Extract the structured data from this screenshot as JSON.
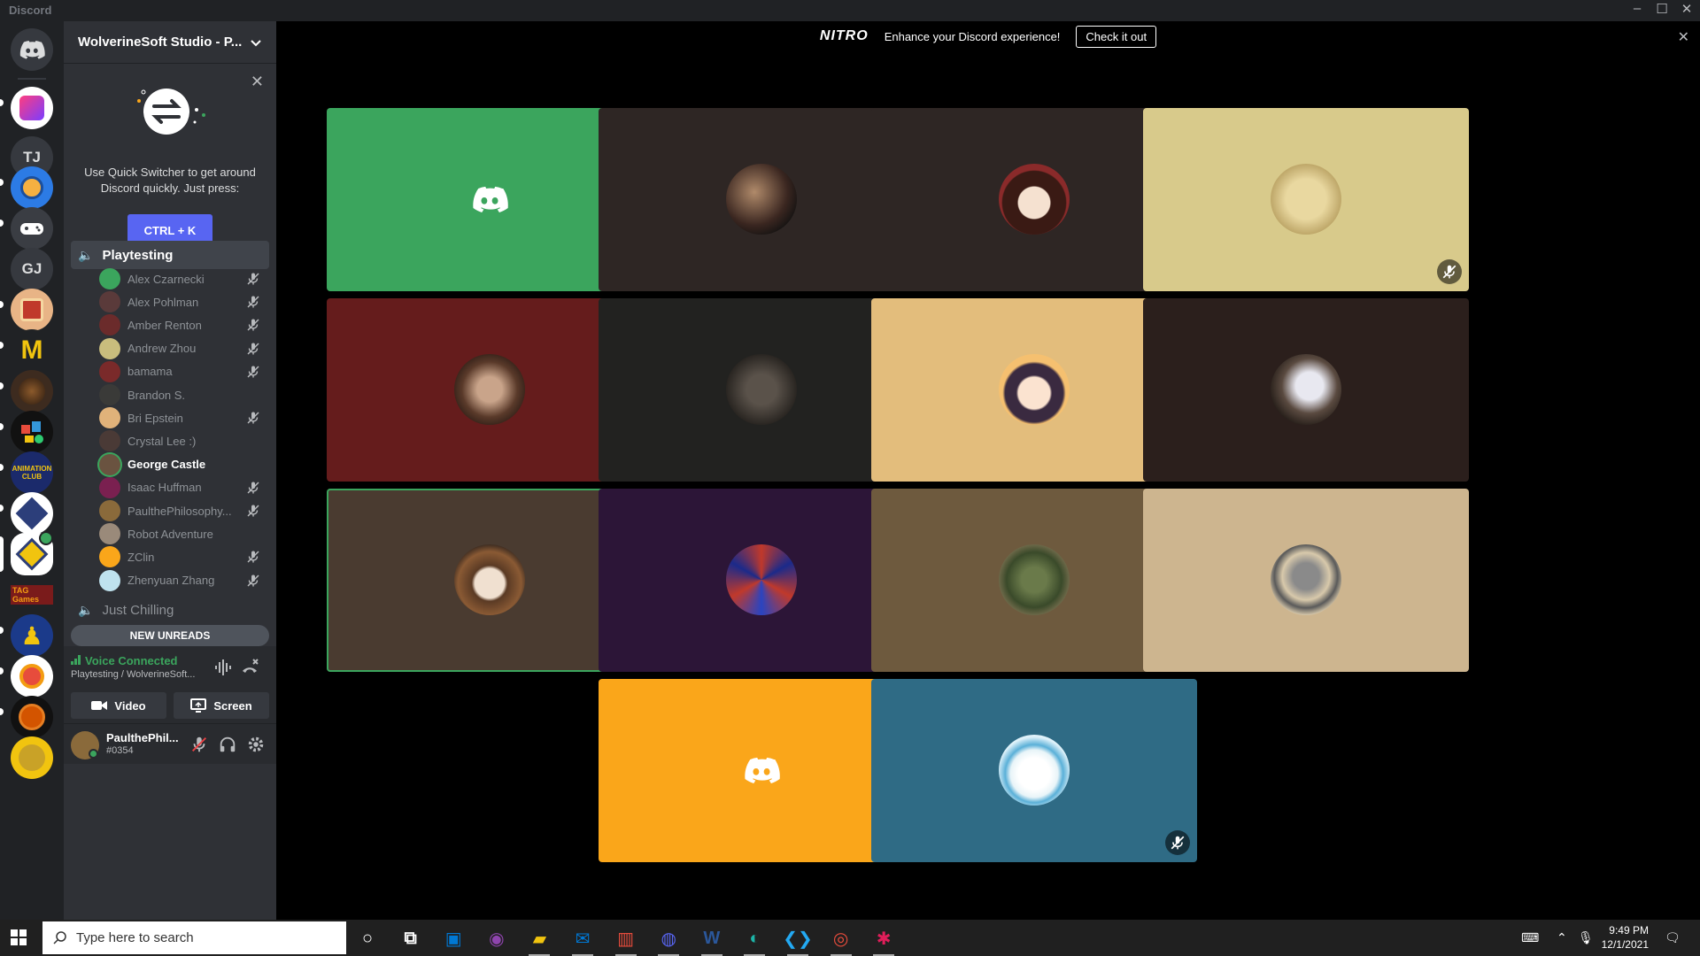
{
  "window": {
    "title": "Discord",
    "controls": [
      "minimize",
      "maximize",
      "close"
    ]
  },
  "server_rail": {
    "items": [
      {
        "name": "home-icon",
        "label": ""
      },
      {
        "name": "server-1",
        "label": ""
      },
      {
        "name": "server-tj",
        "label": "TJ"
      },
      {
        "name": "server-3",
        "label": ""
      },
      {
        "name": "server-4",
        "label": ""
      },
      {
        "name": "server-gj",
        "label": "GJ"
      },
      {
        "name": "server-6",
        "label": ""
      },
      {
        "name": "server-7",
        "label": ""
      },
      {
        "name": "server-8",
        "label": ""
      },
      {
        "name": "server-9",
        "label": ""
      },
      {
        "name": "server-10",
        "label": ""
      },
      {
        "name": "server-11",
        "label": ""
      },
      {
        "name": "server-12",
        "label": ""
      },
      {
        "name": "server-13",
        "label": ""
      },
      {
        "name": "server-14",
        "label": ""
      },
      {
        "name": "server-15",
        "label": ""
      },
      {
        "name": "server-16",
        "label": ""
      }
    ]
  },
  "sidebar": {
    "guild_name": "WolverineSoft Studio - P...",
    "quick_switcher": {
      "text": "Use Quick Switcher to get around Discord quickly. Just press:",
      "key": "CTRL + K"
    },
    "channels": [
      {
        "name": "Playtesting",
        "active": true
      },
      {
        "name": "Just Chilling",
        "active": false
      }
    ],
    "voice_users": [
      {
        "name": "Alex Czarnecki",
        "muted": true,
        "speaking": false,
        "color": "#3ba55d"
      },
      {
        "name": "Alex Pohlman",
        "muted": true,
        "speaking": false,
        "color": "#5a3a3a"
      },
      {
        "name": "Amber Renton",
        "muted": true,
        "speaking": false,
        "color": "#6b2b2b"
      },
      {
        "name": "Andrew Zhou",
        "muted": true,
        "speaking": false,
        "color": "#c9bd7d"
      },
      {
        "name": "bamama",
        "muted": true,
        "speaking": false,
        "color": "#7a2a2a"
      },
      {
        "name": "Brandon S.",
        "muted": false,
        "speaking": false,
        "color": "#3a3a38"
      },
      {
        "name": "Bri Epstein",
        "muted": true,
        "speaking": false,
        "color": "#e0b27a"
      },
      {
        "name": "Crystal Lee :)",
        "muted": false,
        "speaking": false,
        "color": "#4a3a36"
      },
      {
        "name": "George Castle",
        "muted": false,
        "speaking": true,
        "color": "#6a5340"
      },
      {
        "name": "Isaac Huffman",
        "muted": true,
        "speaking": false,
        "color": "#7a2050"
      },
      {
        "name": "PaulthePhilosophy...",
        "muted": true,
        "speaking": false,
        "color": "#8a6a3b"
      },
      {
        "name": "Robot Adventure",
        "muted": false,
        "speaking": false,
        "color": "#9a8a7a"
      },
      {
        "name": "ZClin",
        "muted": true,
        "speaking": false,
        "color": "#faa61a"
      },
      {
        "name": "Zhenyuan Zhang",
        "muted": true,
        "speaking": false,
        "color": "#bfe2ee"
      }
    ],
    "new_unreads": "NEW UNREADS",
    "voice_connected": {
      "status": "Voice Connected",
      "location": "Playtesting / WolverineSoft...",
      "video_label": "Video",
      "screen_label": "Screen"
    },
    "user": {
      "name": "PaulthePhil...",
      "tag": "#0354"
    }
  },
  "nitro_banner": {
    "logo": "NITRO",
    "text": "Enhance your Discord experience!",
    "cta": "Check it out"
  },
  "video_grid": {
    "tiles": [
      {
        "bg": "#3ba55d",
        "avatar": "discord-logo",
        "muted": true
      },
      {
        "bg": "#2e2624",
        "avatar": "photo-dark",
        "muted": true
      },
      {
        "bg": "#2e2624",
        "avatar": "cartoon-girl",
        "muted": true
      },
      {
        "bg": "#d8ca8b",
        "avatar": "cookie-face",
        "muted": true
      },
      {
        "bg": "#651c1c",
        "avatar": "photo-people",
        "muted": true
      },
      {
        "bg": "#222220",
        "avatar": "photo-animal",
        "muted": false
      },
      {
        "bg": "#e3bd7c",
        "avatar": "anime-girl",
        "muted": true
      },
      {
        "bg": "#2b1f1c",
        "avatar": "photo-cat",
        "muted": false
      },
      {
        "bg": "#4a3b30",
        "avatar": "glasses-guy",
        "muted": false,
        "speaking": true
      },
      {
        "bg": "#2c1537",
        "avatar": "red-fractal",
        "muted": true
      },
      {
        "bg": "#6e5a3e",
        "avatar": "game-character",
        "muted": true
      },
      {
        "bg": "#cdb58f",
        "avatar": "robot-figure",
        "muted": false
      },
      {
        "bg": "#faa61a",
        "avatar": "discord-logo",
        "muted": true
      },
      {
        "bg": "#2f6b85",
        "avatar": "anime-boy",
        "muted": true
      }
    ]
  },
  "taskbar": {
    "search_placeholder": "Type here to search",
    "time": "9:49 PM",
    "date": "12/1/2021",
    "apps": [
      "cortana",
      "task-view",
      "store",
      "podcast",
      "file-explorer",
      "mail",
      "office",
      "discord",
      "word",
      "edge",
      "vscode",
      "chrome",
      "slack"
    ]
  }
}
